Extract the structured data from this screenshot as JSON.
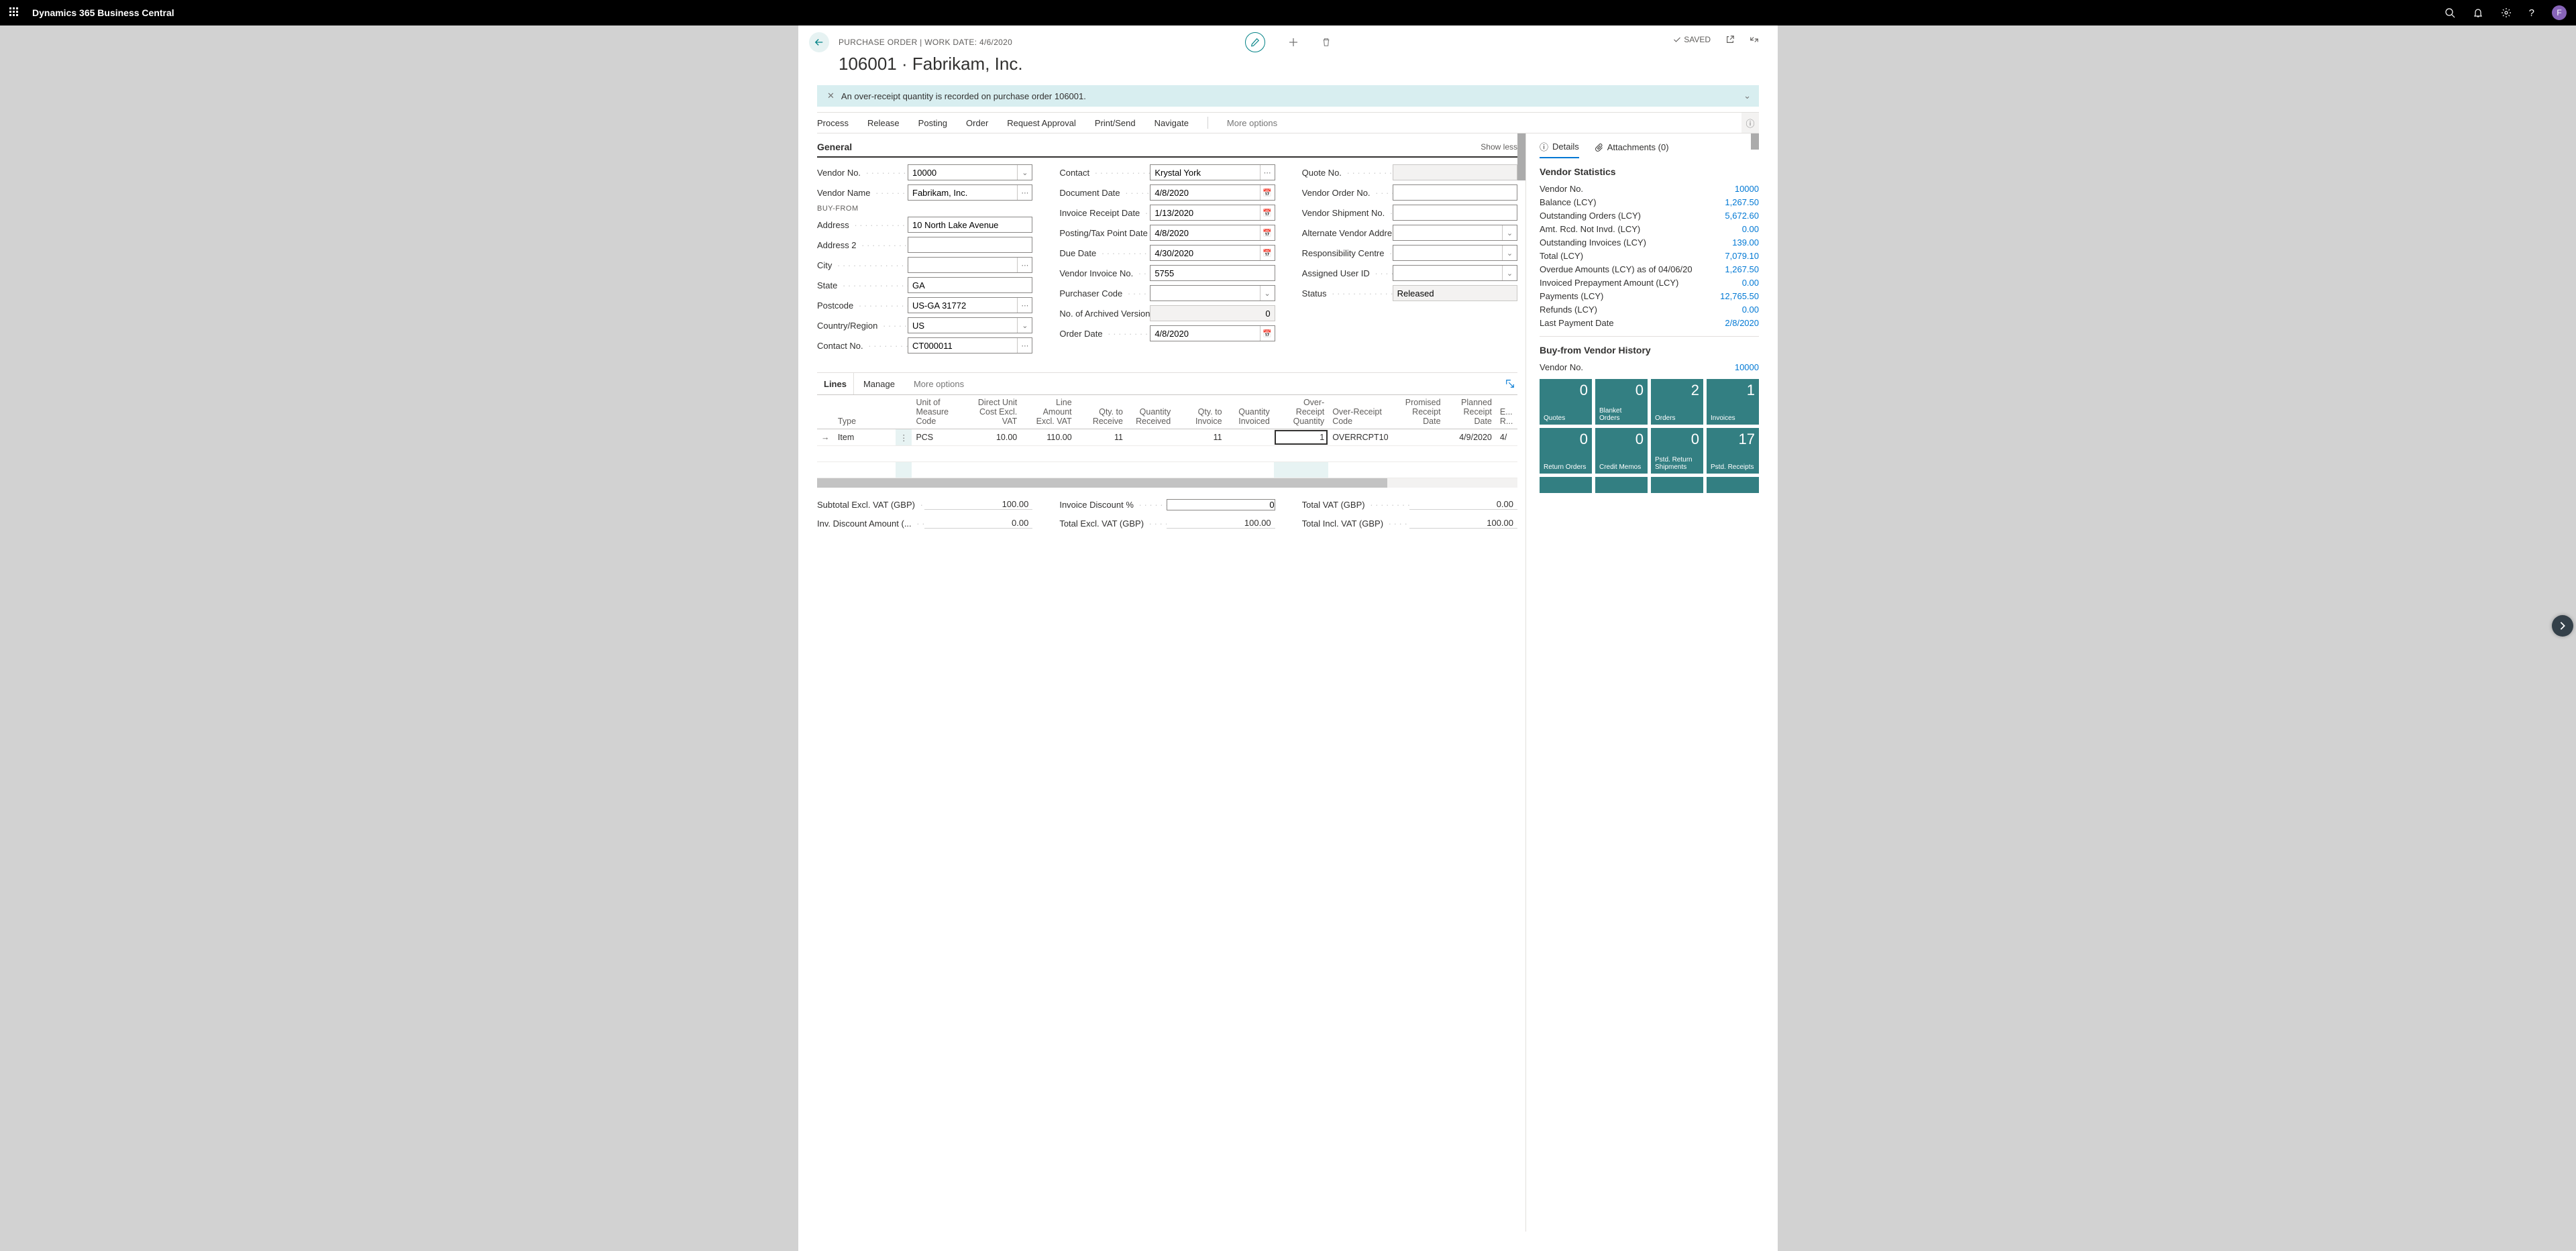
{
  "header": {
    "app_name": "Dynamics 365 Business Central",
    "avatar_initial": "F"
  },
  "page": {
    "crumb": "PURCHASE ORDER | WORK DATE: 4/6/2020",
    "title": "106001 · Fabrikam, Inc.",
    "saved_label": "SAVED",
    "notice_text": "An over-receipt quantity is recorded on purchase order 106001.",
    "action_items": [
      "Process",
      "Release",
      "Posting",
      "Order",
      "Request Approval",
      "Print/Send",
      "Navigate"
    ],
    "action_more": "More options"
  },
  "general": {
    "title": "General",
    "show_less": "Show less",
    "buy_from": "BUY-FROM",
    "vendor_no": {
      "label": "Vendor No.",
      "value": "10000"
    },
    "vendor_name": {
      "label": "Vendor Name",
      "value": "Fabrikam, Inc."
    },
    "address": {
      "label": "Address",
      "value": "10 North Lake Avenue"
    },
    "address2": {
      "label": "Address 2",
      "value": ""
    },
    "city": {
      "label": "City",
      "value": ""
    },
    "state": {
      "label": "State",
      "value": "GA"
    },
    "postcode": {
      "label": "Postcode",
      "value": "US-GA 31772"
    },
    "country": {
      "label": "Country/Region",
      "value": "US"
    },
    "contact_no": {
      "label": "Contact No.",
      "value": "CT000011"
    },
    "contact": {
      "label": "Contact",
      "value": "Krystal York"
    },
    "doc_date": {
      "label": "Document Date",
      "value": "4/8/2020"
    },
    "inv_rcpt_date": {
      "label": "Invoice Receipt Date",
      "value": "1/13/2020"
    },
    "posting_date": {
      "label": "Posting/Tax Point Date",
      "value": "4/8/2020"
    },
    "due_date": {
      "label": "Due Date",
      "value": "4/30/2020"
    },
    "vendor_inv_no": {
      "label": "Vendor Invoice No.",
      "value": "5755"
    },
    "purchaser_code": {
      "label": "Purchaser Code",
      "value": ""
    },
    "archived": {
      "label": "No. of Archived Versions",
      "value": "0"
    },
    "order_date": {
      "label": "Order Date",
      "value": "4/8/2020"
    },
    "quote_no": {
      "label": "Quote No.",
      "value": ""
    },
    "vendor_order_no": {
      "label": "Vendor Order No.",
      "value": ""
    },
    "vendor_ship_no": {
      "label": "Vendor Shipment No.",
      "value": ""
    },
    "alt_vendor": {
      "label": "Alternate Vendor Addre...",
      "value": ""
    },
    "resp_centre": {
      "label": "Responsibility Centre",
      "value": ""
    },
    "assigned_user": {
      "label": "Assigned User ID",
      "value": ""
    },
    "status": {
      "label": "Status",
      "value": "Released"
    }
  },
  "lines": {
    "tab": "Lines",
    "manage": "Manage",
    "more": "More options",
    "headers": [
      "Type",
      "Unit of Measure Code",
      "Direct Unit Cost Excl. VAT",
      "Line Amount Excl. VAT",
      "Qty. to Receive",
      "Quantity Received",
      "Qty. to Invoice",
      "Quantity Invoiced",
      "Over-Receipt Quantity",
      "Over-Receipt Code",
      "Promised Receipt Date",
      "Planned Receipt Date",
      "E... R..."
    ],
    "row": {
      "type": "Item",
      "uom": "PCS",
      "unit_cost": "10.00",
      "line_amt": "110.00",
      "qty_to_receive": "11",
      "qty_received": "",
      "qty_to_invoice": "11",
      "qty_invoiced": "",
      "over_qty": "1",
      "over_code": "OVERRCPT10",
      "promised": "",
      "planned": "4/9/2020",
      "ext": "4/"
    }
  },
  "totals": {
    "subtotal": {
      "label": "Subtotal Excl. VAT (GBP)",
      "value": "100.00"
    },
    "inv_disc_amt": {
      "label": "Inv. Discount Amount (...",
      "value": "0.00"
    },
    "inv_disc_pct": {
      "label": "Invoice Discount %",
      "value": "0"
    },
    "total_excl": {
      "label": "Total Excl. VAT (GBP)",
      "value": "100.00"
    },
    "total_vat": {
      "label": "Total VAT (GBP)",
      "value": "0.00"
    },
    "total_incl": {
      "label": "Total Incl. VAT (GBP)",
      "value": "100.00"
    }
  },
  "factbox": {
    "tabs": {
      "details": "Details",
      "attachments": "Attachments (0)"
    },
    "stats_title": "Vendor Statistics",
    "vendor_no": {
      "label": "Vendor No.",
      "value": "10000"
    },
    "stats": [
      {
        "label": "Balance (LCY)",
        "value": "1,267.50"
      },
      {
        "label": "Outstanding Orders (LCY)",
        "value": "5,672.60"
      },
      {
        "label": "Amt. Rcd. Not Invd. (LCY)",
        "value": "0.00"
      },
      {
        "label": "Outstanding Invoices (LCY)",
        "value": "139.00"
      },
      {
        "label": "Total (LCY)",
        "value": "7,079.10"
      },
      {
        "label": "Overdue Amounts (LCY) as of 04/06/20",
        "value": "1,267.50"
      },
      {
        "label": "Invoiced Prepayment Amount (LCY)",
        "value": "0.00"
      },
      {
        "label": "Payments (LCY)",
        "value": "12,765.50"
      },
      {
        "label": "Refunds (LCY)",
        "value": "0.00"
      },
      {
        "label": "Last Payment Date",
        "value": "2/8/2020"
      }
    ],
    "history_title": "Buy-from Vendor History",
    "history_vendor_no": {
      "label": "Vendor No.",
      "value": "10000"
    },
    "tiles": [
      {
        "num": "0",
        "lbl": "Quotes"
      },
      {
        "num": "0",
        "lbl": "Blanket Orders"
      },
      {
        "num": "2",
        "lbl": "Orders"
      },
      {
        "num": "1",
        "lbl": "Invoices"
      },
      {
        "num": "0",
        "lbl": "Return Orders"
      },
      {
        "num": "0",
        "lbl": "Credit Memos"
      },
      {
        "num": "0",
        "lbl": "Pstd. Return Shipments"
      },
      {
        "num": "17",
        "lbl": "Pstd. Receipts"
      }
    ]
  }
}
